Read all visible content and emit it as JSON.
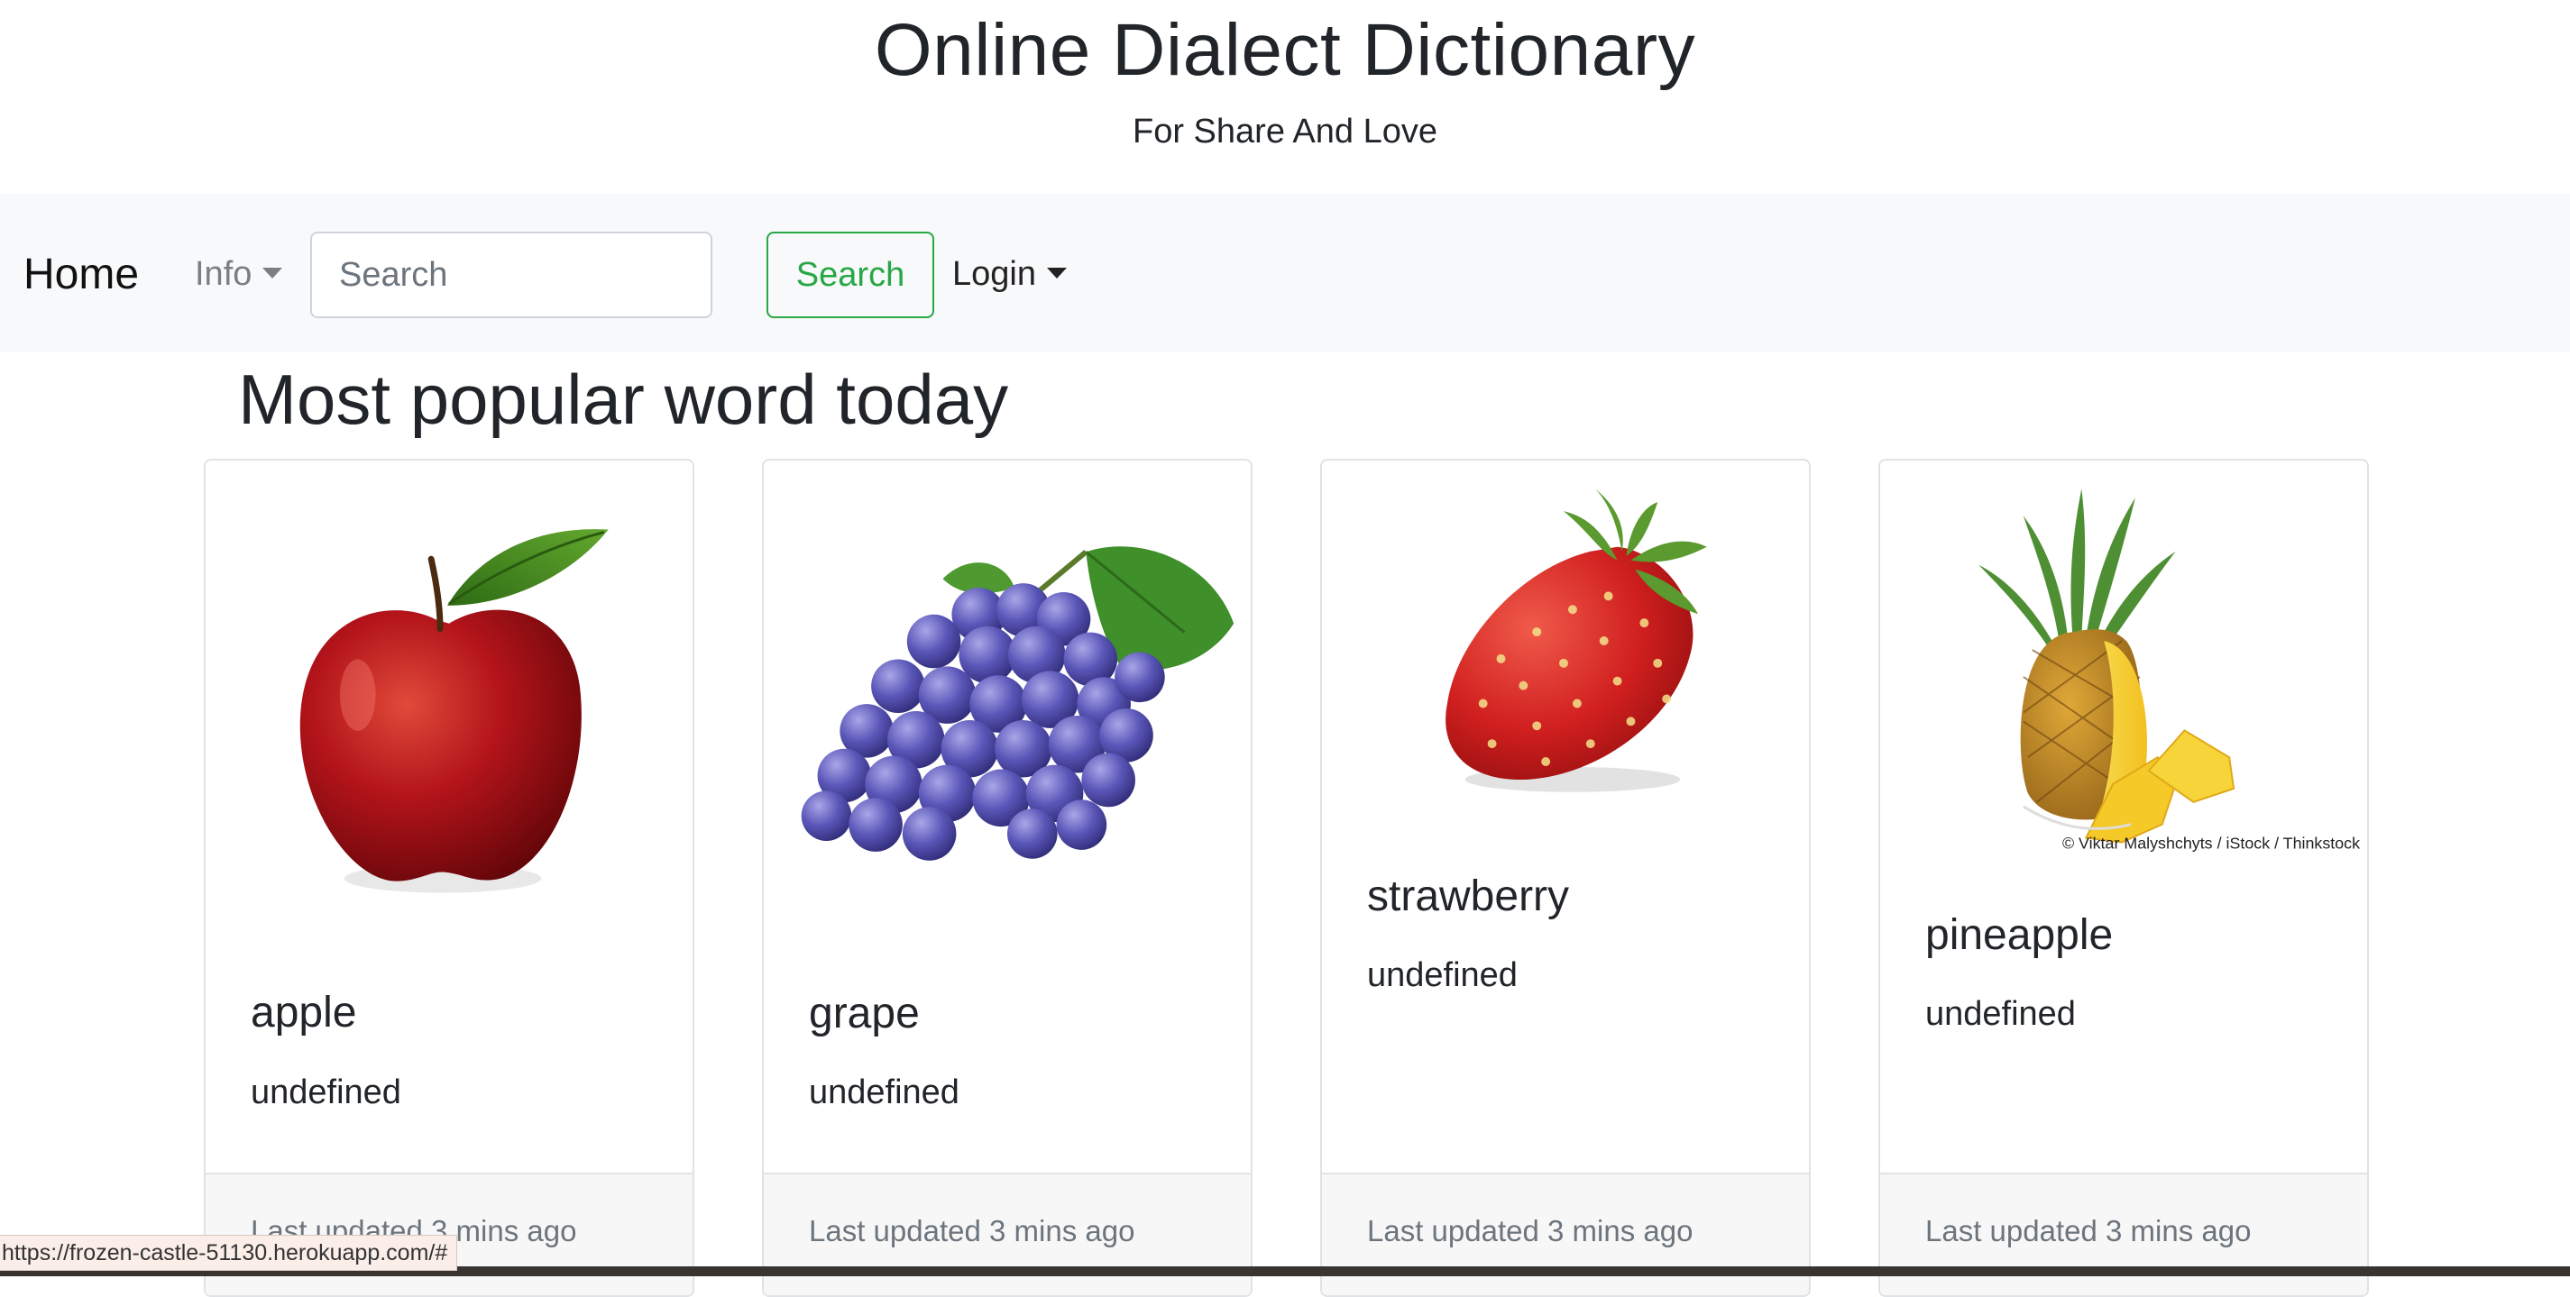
{
  "header": {
    "title": "Online Dialect Dictionary",
    "subtitle": "For Share And Love"
  },
  "navbar": {
    "brand": "Home",
    "info_label": "Info",
    "search_placeholder": "Search",
    "search_value": "",
    "search_button": "Search",
    "login_label": "Login"
  },
  "section": {
    "heading": "Most popular word today"
  },
  "cards": [
    {
      "word": "apple",
      "definition": "undefined",
      "updated": "Last updated 3 mins ago",
      "image": "apple-image"
    },
    {
      "word": "grape",
      "definition": "undefined",
      "updated": "Last updated 3 mins ago",
      "image": "grape-image"
    },
    {
      "word": "strawberry",
      "definition": "undefined",
      "updated": "Last updated 3 mins ago",
      "image": "strawberry-image"
    },
    {
      "word": "pineapple",
      "definition": "undefined",
      "updated": "Last updated 3 mins ago",
      "image": "pineapple-image",
      "image_credit": "© Viktar Malyshchyts / iStock / Thinkstock"
    }
  ],
  "status_bar": {
    "url": "https://frozen-castle-51130.herokuapp.com/#"
  },
  "colors": {
    "navbar_bg": "#f8f9fa",
    "search_button": "#28a745",
    "card_footer_bg": "#f7f7f7",
    "muted_text": "#6c757d"
  }
}
